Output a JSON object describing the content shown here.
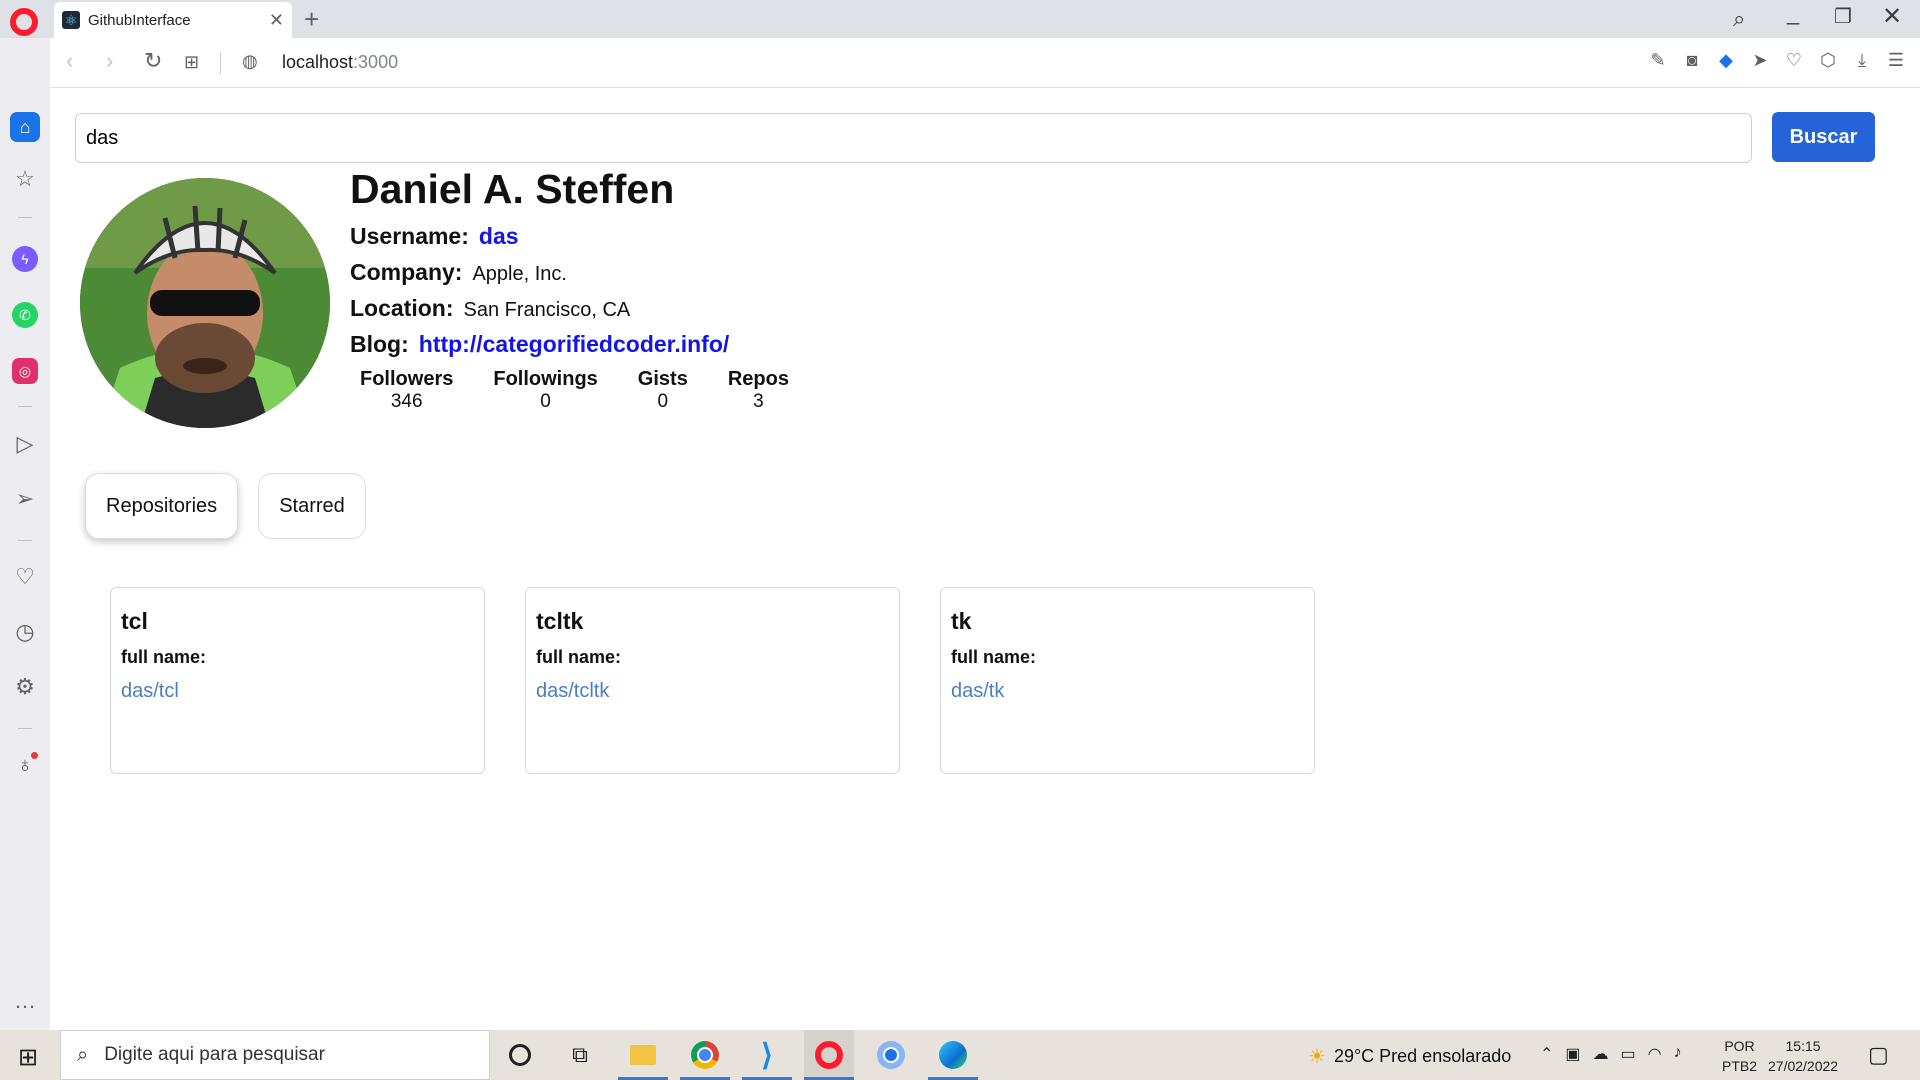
{
  "browser": {
    "tab_title": "GithubInterface",
    "tab_favicon": "⚛",
    "new_tab": "+",
    "url_host": "localhost",
    "url_port": ":3000"
  },
  "search": {
    "value": "das",
    "button_label": "Buscar"
  },
  "profile": {
    "name": "Daniel A. Steffen",
    "username_label": "Username:",
    "username": "das",
    "company_label": "Company:",
    "company": "Apple, Inc.",
    "location_label": "Location:",
    "location": "San Francisco, CA",
    "blog_label": "Blog:",
    "blog": "http://categorifiedcoder.info/",
    "stats": [
      {
        "label": "Followers",
        "value": "346"
      },
      {
        "label": "Followings",
        "value": "0"
      },
      {
        "label": "Gists",
        "value": "0"
      },
      {
        "label": "Repos",
        "value": "3"
      }
    ]
  },
  "tabs": {
    "repositories": "Repositories",
    "starred": "Starred"
  },
  "repos": [
    {
      "name": "tcl",
      "full_name_label": "full name:",
      "full_name": "das/tcl"
    },
    {
      "name": "tcltk",
      "full_name_label": "full name:",
      "full_name": "das/tcltk"
    },
    {
      "name": "tk",
      "full_name_label": "full name:",
      "full_name": "das/tk"
    }
  ],
  "taskbar": {
    "search_placeholder": "Digite aqui para pesquisar",
    "weather": "29°C  Pred ensolarado",
    "lang_top": "POR",
    "lang_bottom": "PTB2",
    "time": "15:15",
    "date": "27/02/2022"
  },
  "colors": {
    "accent": "#2563d9",
    "link": "#1414e6",
    "repo_link": "#4a7fc4"
  }
}
